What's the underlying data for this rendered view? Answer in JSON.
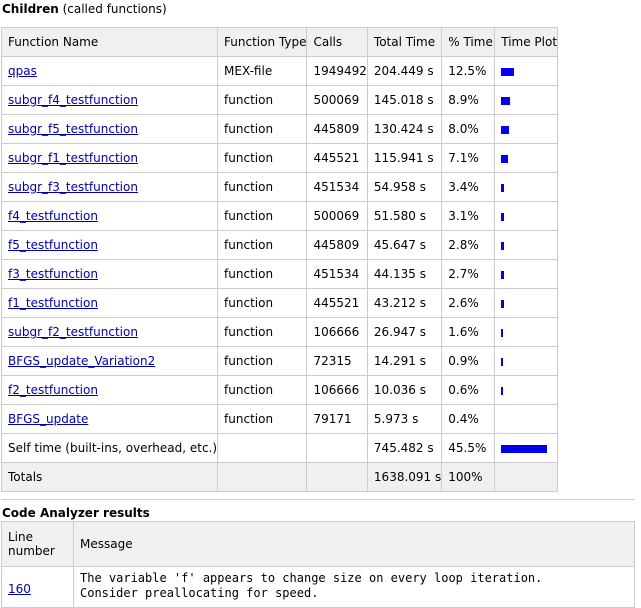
{
  "children": {
    "title": "Children",
    "subtitle": "(called functions)",
    "headers": [
      "Function Name",
      "Function Type",
      "Calls",
      "Total Time",
      "% Time",
      "Time Plot"
    ],
    "rows": [
      {
        "name": "qpas",
        "type": "MEX-file",
        "calls": "1949492",
        "total": "204.449 s",
        "pct": "12.5%",
        "plot": 0.125
      },
      {
        "name": "subgr_f4_testfunction",
        "type": "function",
        "calls": "500069",
        "total": "145.018 s",
        "pct": "8.9%",
        "plot": 0.089
      },
      {
        "name": "subgr_f5_testfunction",
        "type": "function",
        "calls": "445809",
        "total": "130.424 s",
        "pct": "8.0%",
        "plot": 0.08
      },
      {
        "name": "subgr_f1_testfunction",
        "type": "function",
        "calls": "445521",
        "total": "115.941 s",
        "pct": "7.1%",
        "plot": 0.071
      },
      {
        "name": "subgr_f3_testfunction",
        "type": "function",
        "calls": "451534",
        "total": "54.958 s",
        "pct": "3.4%",
        "plot": 0.034
      },
      {
        "name": "f4_testfunction",
        "type": "function",
        "calls": "500069",
        "total": "51.580 s",
        "pct": "3.1%",
        "plot": 0.031
      },
      {
        "name": "f5_testfunction",
        "type": "function",
        "calls": "445809",
        "total": "45.647 s",
        "pct": "2.8%",
        "plot": 0.028
      },
      {
        "name": "f3_testfunction",
        "type": "function",
        "calls": "451534",
        "total": "44.135 s",
        "pct": "2.7%",
        "plot": 0.027
      },
      {
        "name": "f1_testfunction",
        "type": "function",
        "calls": "445521",
        "total": "43.212 s",
        "pct": "2.6%",
        "plot": 0.026
      },
      {
        "name": "subgr_f2_testfunction",
        "type": "function",
        "calls": "106666",
        "total": "26.947 s",
        "pct": "1.6%",
        "plot": 0.016
      },
      {
        "name": "BFGS_update_Variation2",
        "type": "function",
        "calls": "72315",
        "total": "14.291 s",
        "pct": "0.9%",
        "plot": 0.009
      },
      {
        "name": "f2_testfunction",
        "type": "function",
        "calls": "106666",
        "total": "10.036 s",
        "pct": "0.6%",
        "plot": 0.006
      },
      {
        "name": "BFGS_update",
        "type": "function",
        "calls": "79171",
        "total": "5.973 s",
        "pct": "0.4%",
        "plot": 0.0
      }
    ],
    "self_time": {
      "label": "Self time (built-ins, overhead, etc.)",
      "total": "745.482 s",
      "pct": "45.5%",
      "plot": 0.455
    },
    "totals": {
      "label": "Totals",
      "total": "1638.091 s",
      "pct": "100%"
    }
  },
  "code_analyzer": {
    "title": "Code Analyzer results",
    "headers": [
      "Line\nnumber",
      "Message"
    ],
    "rows": [
      {
        "line": "160",
        "message": "The variable 'f' appears to change size on every loop iteration.\nConsider preallocating for speed."
      }
    ]
  },
  "colors": {
    "bar": "#0000ee",
    "link": "#0000aa",
    "header_bg": "#f0f0f0",
    "border": "#cccccc"
  }
}
